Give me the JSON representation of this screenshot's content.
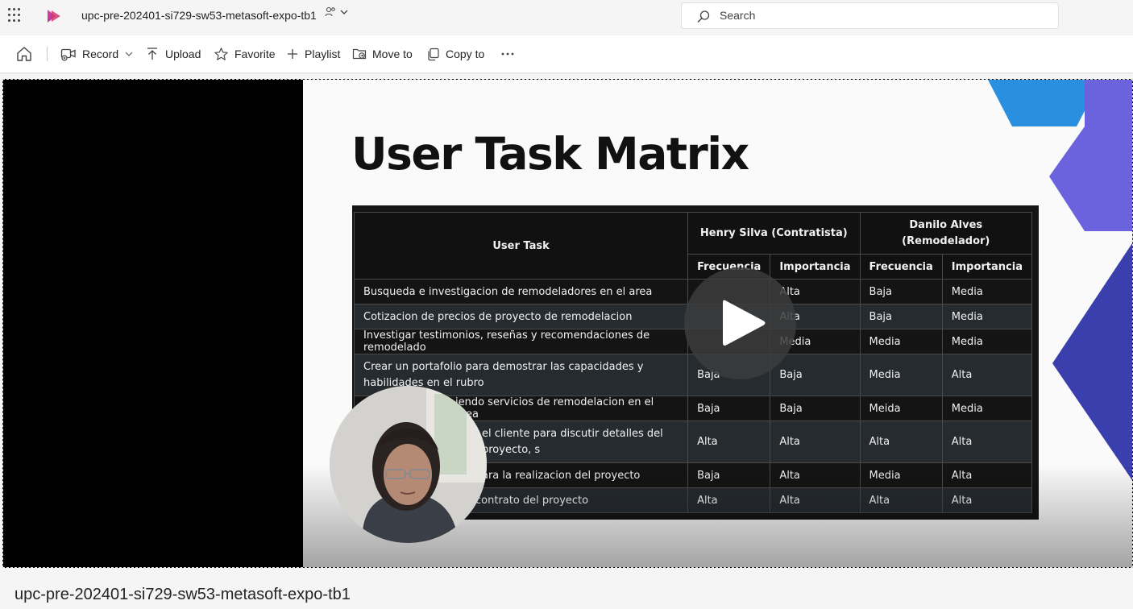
{
  "header": {
    "doc_title": "upc-pre-202401-si729-sw53-metasoft-expo-tb1",
    "search_placeholder": "Search"
  },
  "toolbar": {
    "record": "Record",
    "upload": "Upload",
    "favorite": "Favorite",
    "playlist": "Playlist",
    "move_to": "Move to",
    "copy_to": "Copy to"
  },
  "slide": {
    "title": "User Task Matrix",
    "table": {
      "col_task": "User Task",
      "group1": "Henry Silva (Contratista)",
      "group2_line1": "Danilo Alves",
      "group2_line2": "(Remodelador)",
      "sub_freq": "Frecuencia",
      "sub_imp": "Importancia",
      "rows": [
        {
          "task": "Busqueda e investigacion de remodeladores en el area",
          "h_freq": "",
          "h_imp": "Alta",
          "d_freq": "Baja",
          "d_imp": "Media"
        },
        {
          "task": "Cotizacion de precios de proyecto de remodelacion",
          "h_freq": "",
          "h_imp": "Alta",
          "d_freq": "Baja",
          "d_imp": "Media"
        },
        {
          "task": "Investigar testimonios, reseñas y recomendaciones de remodelado",
          "h_freq": "",
          "h_imp": "Media",
          "d_freq": "Media",
          "d_imp": "Media"
        },
        {
          "task": "Crear un portafolio para demostrar las capacidades y habilidades en el rubro",
          "h_freq": "Baja",
          "h_imp": "Baja",
          "d_freq": "Media",
          "d_imp": "Alta"
        },
        {
          "task": "iendo servicios de remodelacion en el area",
          "h_freq": "Baja",
          "h_imp": "Baja",
          "d_freq": "Meida",
          "d_imp": "Media"
        },
        {
          "task": "el cliente para discutir detalles del proyecto, s",
          "h_freq": "Alta",
          "h_imp": "Alta",
          "d_freq": "Alta",
          "d_imp": "Alta"
        },
        {
          "task": "ara la realizacion del proyecto",
          "h_freq": "Baja",
          "h_imp": "Alta",
          "d_freq": "Media",
          "d_imp": "Alta"
        },
        {
          "task": "contrato del proyecto",
          "h_freq": "Alta",
          "h_imp": "Alta",
          "d_freq": "Alta",
          "d_imp": "Alta"
        }
      ]
    }
  },
  "footer": {
    "video_title": "upc-pre-202401-si729-sw53-metasoft-expo-tb1"
  },
  "colors": {
    "brand": "#c43e9a",
    "accent_blue": "#2b8fe0",
    "accent_purple": "#6b63dd",
    "accent_indigo": "#3b3fae"
  }
}
